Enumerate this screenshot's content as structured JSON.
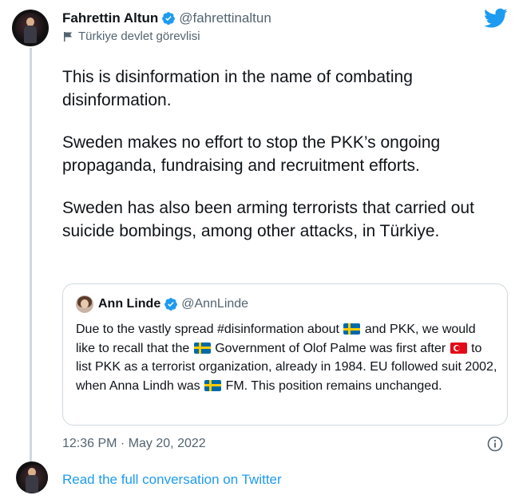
{
  "author": {
    "display_name": "Fahrettin Altun",
    "handle": "@fahrettinaltun",
    "label": "Türkiye devlet görevlisi",
    "verified": true
  },
  "tweet": {
    "paragraphs": [
      "This is disinformation in the name of combating disinformation.",
      "Sweden makes no effort to stop the PKK’s ongoing propaganda, fundraising and recruitment efforts.",
      "Sweden has also been arming terrorists that carried out suicide bombings, among other attacks, in Türkiye."
    ],
    "timestamp": "12:36 PM · May 20, 2022"
  },
  "quoted_tweet": {
    "display_name": "Ann Linde",
    "handle": "@AnnLinde",
    "verified": true,
    "text_parts": {
      "p1": "Due to the vastly spread #disinformation about",
      "p2": "and PKK, we would like to recall that the",
      "p3": "Government of Olof Palme was first after",
      "p4": "to list PKK as a terrorist organization, already in 1984. EU followed suit 2002, when Anna Lindh was",
      "p5": "FM. This position remains unchanged."
    }
  },
  "footer": {
    "read_link": "Read the full conversation on Twitter"
  },
  "icons": {
    "brand": "twitter-bird-icon",
    "verified": "verified-badge-icon",
    "label": "flag-icon",
    "info": "info-icon"
  },
  "colors": {
    "twitter_blue": "#1d9bf0",
    "secondary_text": "#536471",
    "border": "#cfd9de"
  }
}
